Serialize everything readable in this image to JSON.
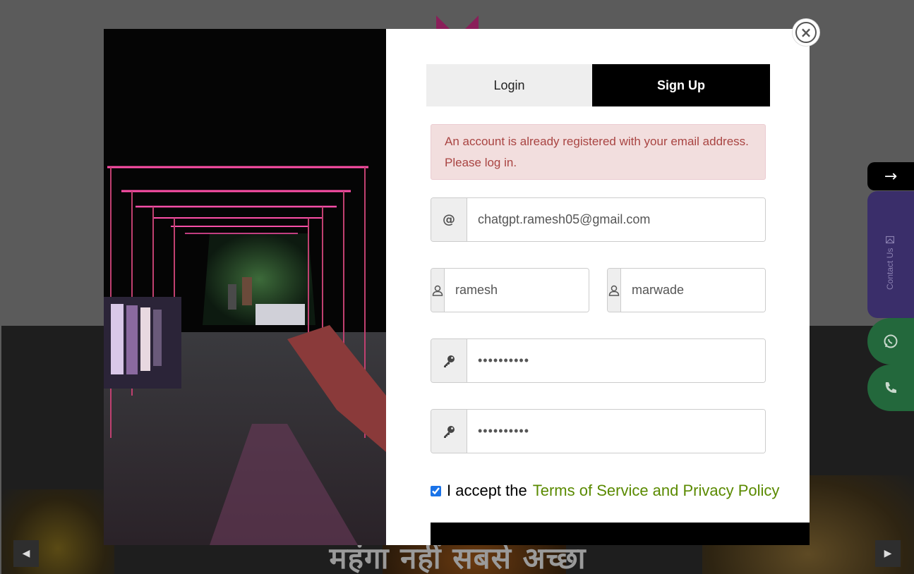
{
  "background": {
    "hero_text": "महंगा नहीं सबसे अच्छा"
  },
  "side_widgets": {
    "arrow": "→",
    "contact_label": "Contact Us"
  },
  "modal": {
    "tabs": [
      {
        "label": "Login",
        "active": false
      },
      {
        "label": "Sign Up",
        "active": true
      }
    ],
    "alert": "An account is already registered with your email address. Please log in.",
    "fields": {
      "email": {
        "icon": "at-icon",
        "value": "chatgpt.ramesh05@gmail.com"
      },
      "first_name": {
        "icon": "user-icon",
        "value": "ramesh"
      },
      "last_name": {
        "icon": "user-icon",
        "value": "marwade"
      },
      "password": {
        "icon": "key-icon",
        "value": "••••••••••"
      },
      "confirm_password": {
        "icon": "key-icon",
        "value": "••••••••••"
      }
    },
    "terms": {
      "prefix": "I accept the",
      "link": "Terms of Service and Privacy Policy",
      "checked": true
    }
  },
  "colors": {
    "alert_bg": "#f2dede",
    "alert_text": "#a94442",
    "link": "#5a8a00",
    "active_tab": "#000000"
  }
}
